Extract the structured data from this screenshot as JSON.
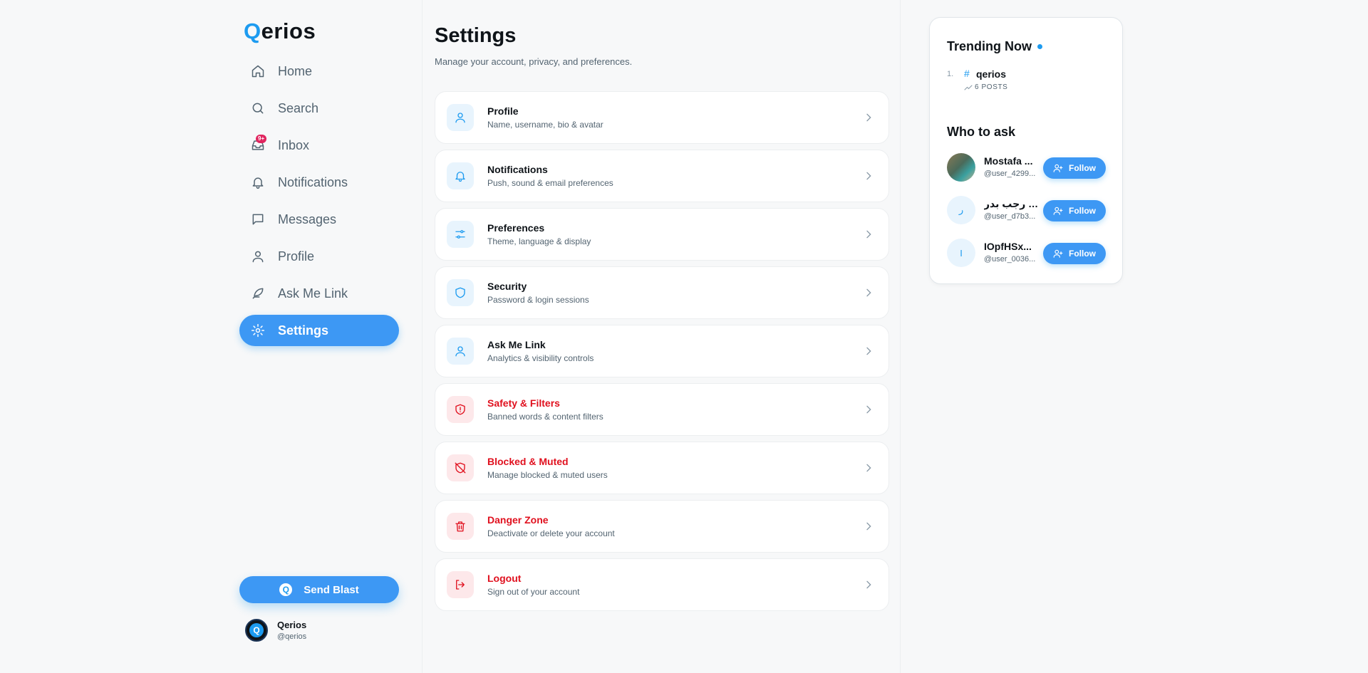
{
  "brand": {
    "logo_q": "Q",
    "logo_rest": "erios",
    "accent": "#3d98f4",
    "danger": "#e0101e"
  },
  "nav": {
    "items": [
      {
        "label": "Home",
        "icon": "home-icon"
      },
      {
        "label": "Search",
        "icon": "search-icon"
      },
      {
        "label": "Inbox",
        "icon": "inbox-icon",
        "badge": "9+"
      },
      {
        "label": "Notifications",
        "icon": "bell-icon"
      },
      {
        "label": "Messages",
        "icon": "message-icon"
      },
      {
        "label": "Profile",
        "icon": "user-icon"
      },
      {
        "label": "Ask Me Link",
        "icon": "feather-icon"
      },
      {
        "label": "Settings",
        "icon": "gear-icon",
        "active": true
      }
    ],
    "blast_label": "Send Blast",
    "blast_icon_letter": "Q"
  },
  "account": {
    "name": "Qerios",
    "handle": "@qerios",
    "avatar_letter": "Q"
  },
  "settings": {
    "title": "Settings",
    "subtitle": "Manage your account, privacy, and preferences.",
    "items": [
      {
        "title": "Profile",
        "desc": "Name, username, bio & avatar",
        "icon": "user-icon",
        "danger": false
      },
      {
        "title": "Notifications",
        "desc": "Push, sound & email preferences",
        "icon": "bell-icon",
        "danger": false
      },
      {
        "title": "Preferences",
        "desc": "Theme, language & display",
        "icon": "sliders-icon",
        "danger": false
      },
      {
        "title": "Security",
        "desc": "Password & login sessions",
        "icon": "shield-icon",
        "danger": false
      },
      {
        "title": "Ask Me Link",
        "desc": "Analytics & visibility controls",
        "icon": "user-icon",
        "danger": false
      },
      {
        "title": "Safety & Filters",
        "desc": "Banned words & content filters",
        "icon": "shield-alert-icon",
        "danger": true
      },
      {
        "title": "Blocked & Muted",
        "desc": "Manage blocked & muted users",
        "icon": "shield-off-icon",
        "danger": true
      },
      {
        "title": "Danger Zone",
        "desc": "Deactivate or delete your account",
        "icon": "trash-icon",
        "danger": true
      },
      {
        "title": "Logout",
        "desc": "Sign out of your account",
        "icon": "logout-icon",
        "danger": true
      }
    ]
  },
  "trending": {
    "title": "Trending Now",
    "items": [
      {
        "rank": "1.",
        "hash": "#",
        "tag": "qerios",
        "posts": "6 POSTS"
      }
    ]
  },
  "who_to_ask": {
    "title": "Who to ask",
    "follow_label": "Follow",
    "people": [
      {
        "name": "Mostafa ...",
        "handle": "@user_4299...",
        "avatar": "photo",
        "initial": ""
      },
      {
        "name": "رغد رجب بدر",
        "handle": "@user_d7b3...",
        "avatar": "initial",
        "initial": "ر"
      },
      {
        "name": "IOpfHSx...",
        "handle": "@user_0036...",
        "avatar": "initial",
        "initial": "I"
      }
    ]
  }
}
